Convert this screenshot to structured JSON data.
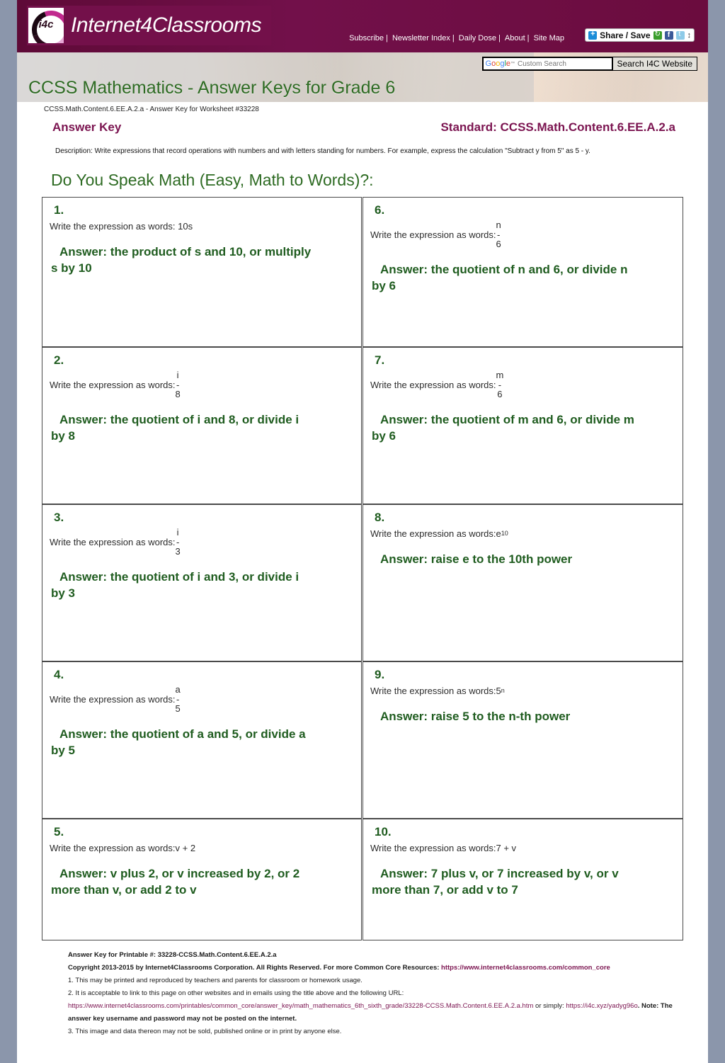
{
  "site": {
    "brand_name": "Internet4Classrooms",
    "logo_text": "i4c",
    "nav": [
      {
        "label": "Subscribe"
      },
      {
        "label": "Newsletter Index"
      },
      {
        "label": "Daily Dose"
      },
      {
        "label": "About"
      },
      {
        "label": "Site Map"
      }
    ],
    "share_label": "Share / Save",
    "share_updown": "↕"
  },
  "search": {
    "google_word": "Google",
    "tm": "™",
    "placeholder": "Custom Search",
    "value": "",
    "button_label": "Search I4C Website"
  },
  "hero": {
    "title": "CCSS Mathematics - Answer Keys for Grade 6"
  },
  "header": {
    "worksheet_id_line": "CCSS.Math.Content.6.EE.A.2.a - Answer Key for Worksheet #33228",
    "answer_key_label": "Answer Key",
    "standard_label": "Standard: CCSS.Math.Content.6.EE.A.2.a",
    "description": "Description: Write expressions that record operations with numbers and with letters standing for numbers. For example, express the calculation \"Subtract y from 5\" as 5 - y.",
    "worksheet_title": "Do You Speak Math (Easy, Math to Words)?:"
  },
  "questions": [
    {
      "num": "1.",
      "prompt": "Write the expression as words: 10s",
      "prompt_prefix": "Write the expression as words: ",
      "expr_type": "plain",
      "expr": "10s",
      "answer_line1": "Answer: the product of s and 10, or multiply",
      "answer_line2": "s by 10"
    },
    {
      "num": "2.",
      "prompt_prefix": "Write the expression as words: ",
      "expr_type": "fraction",
      "numerator": "i",
      "bar": "-",
      "denominator": "8",
      "answer_line1": "Answer: the quotient of i and 8, or divide i",
      "answer_line2": "by 8"
    },
    {
      "num": "3.",
      "prompt_prefix": "Write the expression as words: ",
      "expr_type": "fraction",
      "numerator": "i",
      "bar": "-",
      "denominator": "3",
      "answer_line1": "Answer: the quotient of i and 3, or divide i",
      "answer_line2": "by 3"
    },
    {
      "num": "4.",
      "prompt_prefix": "Write the expression as words: ",
      "expr_type": "fraction",
      "numerator": "a",
      "bar": "-",
      "denominator": "5",
      "answer_line1": "Answer: the quotient of a and 5, or divide a",
      "answer_line2": "by 5"
    },
    {
      "num": "5.",
      "prompt_prefix": "Write the expression as words: ",
      "expr_type": "plain",
      "expr": "v + 2",
      "answer_line1": "Answer: v plus 2, or v increased by 2, or 2",
      "answer_line2": "more than v, or add 2 to v"
    },
    {
      "num": "6.",
      "prompt_prefix": "Write the expression as words: ",
      "expr_type": "fraction",
      "numerator": "n",
      "bar": "-",
      "denominator": "6",
      "answer_line1": "Answer: the quotient of n and 6, or divide n",
      "answer_line2": "by 6"
    },
    {
      "num": "7.",
      "prompt_prefix": "Write the expression as words: ",
      "expr_type": "fraction",
      "numerator": "m",
      "bar": "-",
      "denominator": "6",
      "answer_line1": "Answer: the quotient of m and 6, or divide m",
      "answer_line2": "by 6"
    },
    {
      "num": "8.",
      "prompt_prefix": "Write the expression as words: ",
      "expr_type": "power",
      "base": "e",
      "exponent": "10",
      "answer_line1": "Answer: raise e to the 10th power",
      "answer_line2": ""
    },
    {
      "num": "9.",
      "prompt_prefix": "Write the expression as words: ",
      "expr_type": "power",
      "base": "5",
      "exponent": "n",
      "answer_line1": "Answer: raise 5 to the n-th power",
      "answer_line2": ""
    },
    {
      "num": "10.",
      "prompt_prefix": "Write the expression as words: ",
      "expr_type": "plain",
      "expr": "7 + v",
      "answer_line1": "Answer: 7 plus v, or 7 increased by v, or v",
      "answer_line2": "more than 7, or add v to 7"
    }
  ],
  "footer": {
    "printable_line": "Answer Key for Printable #: 33228-CCSS.Math.Content.6.EE.A.2.a",
    "copyright_prefix": "Copyright 2013-2015 by Internet4Classrooms Corporation. All Rights Reserved. For more Common Core Resources: ",
    "copyright_url": "https://www.internet4classrooms.com/common_core",
    "item1": "1. This may be printed and reproduced by teachers and parents for classroom or homework usage.",
    "item2": "2. It is acceptable to link to this page on other websites and in emails using the title above and the following URL:",
    "item2_url": "https://www.internet4classrooms.com/printables/common_core/answer_key/math_mathematics_6th_sixth_grade/33228-CCSS.Math.Content.6.EE.A.2.a.htm",
    "item2_url_mid": " or simply: ",
    "item2_short_url": "https://i4c.xyz/yadyg96o",
    "item2_note": ". Note: The",
    "item2_cont": "answer key username and password may not be posted on the internet.",
    "item3": "3. This image and data thereon may not be sold, published online or in print by anyone else."
  },
  "colors": {
    "brand_maroon": "#6b0c3e",
    "heading_green": "#2e6b23",
    "answer_green": "#1f5c1f",
    "standard_purple": "#7b1450",
    "page_bg": "#8b96ab"
  }
}
